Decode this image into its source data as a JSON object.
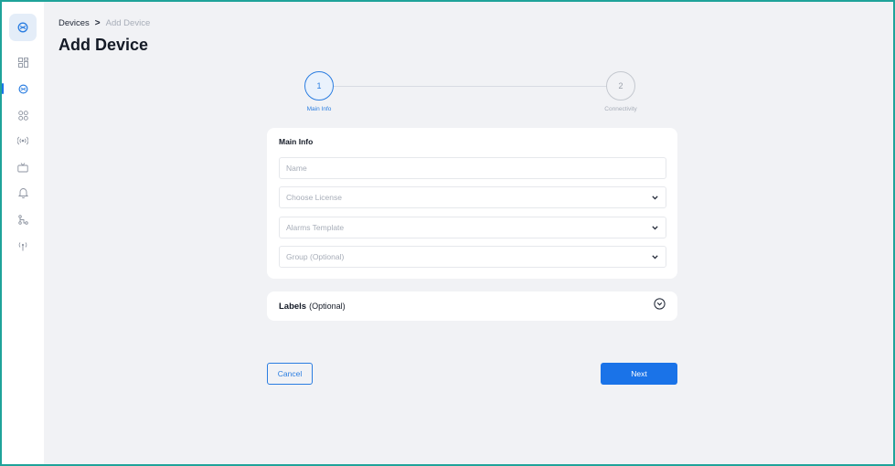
{
  "breadcrumb": {
    "current": "Devices",
    "separator": ">",
    "next": "Add Device"
  },
  "page_title": "Add Device",
  "stepper": {
    "steps": [
      {
        "number": "1",
        "label": "Main Info",
        "state": "active"
      },
      {
        "number": "2",
        "label": "Connectivity",
        "state": "inactive"
      }
    ]
  },
  "main_info": {
    "title": "Main Info",
    "name_placeholder": "Name",
    "license_placeholder": "Choose License",
    "alarms_placeholder": "Alarms Template",
    "group_placeholder": "Group (Optional)"
  },
  "labels_section": {
    "title": "Labels",
    "optional": "(Optional)"
  },
  "actions": {
    "cancel_label": "Cancel",
    "next_label": "Next"
  },
  "sidebar": {
    "items": [
      {
        "icon": "dashboard-icon"
      },
      {
        "icon": "devices-icon",
        "active": true
      },
      {
        "icon": "apps-icon"
      },
      {
        "icon": "broadcast-icon"
      },
      {
        "icon": "tv-icon"
      },
      {
        "icon": "bell-icon"
      },
      {
        "icon": "flow-icon"
      },
      {
        "icon": "tower-icon"
      }
    ]
  },
  "colors": {
    "accent": "#1a73e8",
    "frame_border": "#1fa39a",
    "background": "#f1f2f5"
  }
}
